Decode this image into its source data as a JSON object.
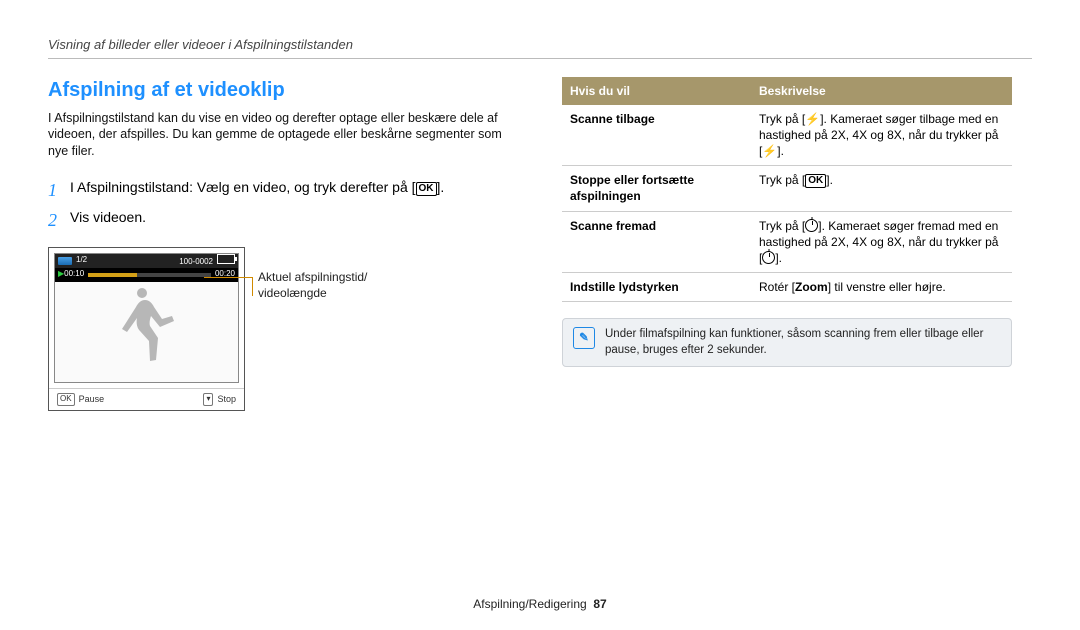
{
  "breadcrumb": "Visning af billeder eller videoer i Afspilningstilstanden",
  "section_title": "Afspilning af et videoklip",
  "intro": "I Afspilningstilstand kan du vise en video og derefter optage eller beskære dele af videoen, der afspilles. Du kan gemme de optagede eller beskårne segmenter som nye filer.",
  "steps": {
    "1": "I Afspilningstilstand: Vælg en video, og tryk derefter på [",
    "1_end": "].",
    "2": "Vis videoen."
  },
  "thumbnail": {
    "index": "1/2",
    "counter": "100-0002",
    "time_current": "00:10",
    "time_total": "00:20",
    "pause": "Pause",
    "stop": "Stop"
  },
  "callout": {
    "l1": "Aktuel afspilningstid/",
    "l2": "videolængde"
  },
  "table": {
    "head_l": "Hvis du vil",
    "head_r": "Beskrivelse",
    "rows": [
      {
        "k": "Scanne tilbage",
        "v_pre": "Tryk på [",
        "v_icon": "bolt",
        "v_mid": "]. Kameraet søger tilbage med en hastighed på 2X, 4X og 8X, når du trykker på [",
        "v_icon2": "bolt",
        "v_post": "]."
      },
      {
        "k": "Stoppe eller fortsætte afspilningen",
        "v_pre": "Tryk på [",
        "v_icon": "ok",
        "v_post": "]."
      },
      {
        "k": "Scanne fremad",
        "v_pre": "Tryk på [",
        "v_icon": "timer",
        "v_mid": "]. Kameraet søger fremad med en hastighed på 2X, 4X og 8X, når du trykker på [",
        "v_icon2": "timer",
        "v_post": "]."
      },
      {
        "k": "Indstille lydstyrken",
        "v_plain_pre": "Rotér [",
        "v_bold": "Zoom",
        "v_plain_post": "] til venstre eller højre."
      }
    ]
  },
  "note": "Under filmafspilning kan funktioner, såsom scanning frem eller tilbage eller pause, bruges efter 2 sekunder.",
  "footer": {
    "l": "Afspilning/Redigering",
    "n": "87"
  }
}
